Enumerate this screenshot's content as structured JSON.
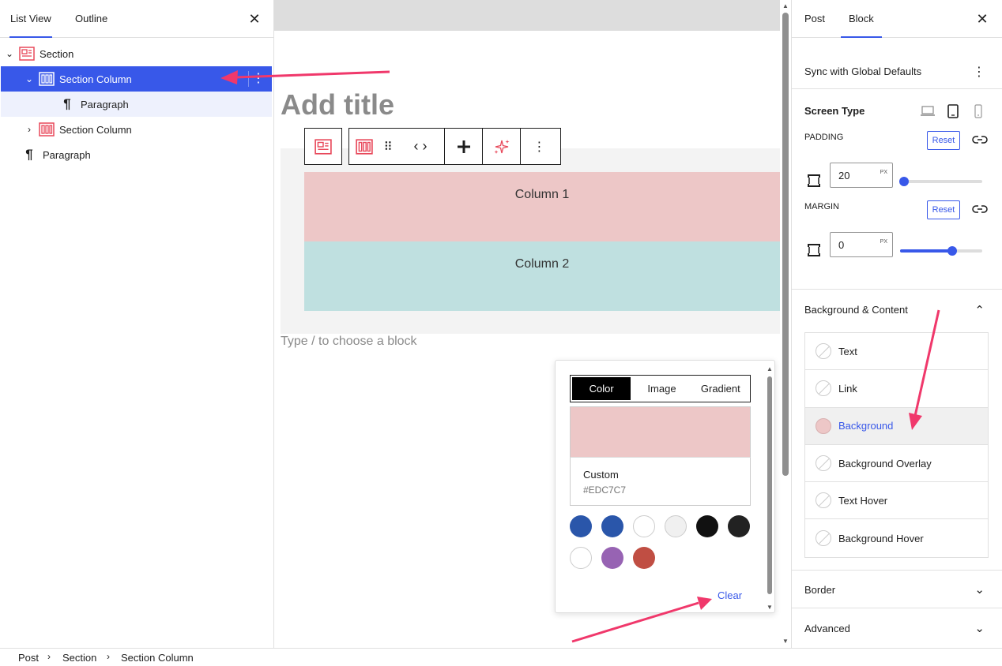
{
  "left_panel": {
    "tabs": [
      "List View",
      "Outline"
    ],
    "active_tab": "List View",
    "close_icon": "close-icon",
    "tree": [
      {
        "label": "Section",
        "depth": 0,
        "expanded": true,
        "icon": "section-icon"
      },
      {
        "label": "Section Column",
        "depth": 1,
        "expanded": true,
        "selected": true,
        "icon": "section-column-icon"
      },
      {
        "label": "Paragraph",
        "depth": 2,
        "icon": "paragraph-icon"
      },
      {
        "label": "Section Column",
        "depth": 1,
        "expanded": false,
        "icon": "section-column-icon"
      },
      {
        "label": "Paragraph",
        "depth": 0,
        "icon": "paragraph-icon"
      }
    ]
  },
  "canvas": {
    "title_placeholder": "Add title",
    "columns": [
      "Column 1",
      "Column 2"
    ],
    "block_hint": "Type / to choose a block",
    "column_colors": [
      "#EDC7C7",
      "#BFE0E0"
    ],
    "toolbar": {
      "buttons": [
        "section-icon",
        "section-column-icon",
        "drag-handle-icon",
        "move-arrows-icon",
        "add-icon",
        "sparkle-icon",
        "more-options-icon"
      ]
    }
  },
  "color_popover": {
    "tabs": [
      "Color",
      "Image",
      "Gradient"
    ],
    "active_tab": "Color",
    "custom_label": "Custom",
    "custom_value": "#EDC7C7",
    "palette": [
      "#2A56AA",
      "#2A56AA",
      "#FFFFFF",
      "#F0F0F0",
      "#111111",
      "#222222",
      "#FFFFFF",
      "#9763B3",
      "#C04E43"
    ],
    "clear_label": "Clear"
  },
  "right_panel": {
    "tabs": [
      "Post",
      "Block"
    ],
    "active_tab": "Block",
    "sync_label": "Sync with Global Defaults",
    "screen_type_label": "Screen Type",
    "screen_icons": [
      "desktop-icon",
      "tablet-icon",
      "mobile-icon"
    ],
    "padding": {
      "label": "PADDING",
      "reset": "Reset",
      "value": "20",
      "unit": "PX",
      "slider_fraction": 0.03
    },
    "margin": {
      "label": "MARGIN",
      "reset": "Reset",
      "value": "0",
      "unit": "PX",
      "slider_fraction": 0.63
    },
    "panels": {
      "background_content": "Background & Content",
      "border": "Border",
      "advanced": "Advanced"
    },
    "color_options": [
      "Text",
      "Link",
      "Background",
      "Background Overlay",
      "Text Hover",
      "Background Hover"
    ],
    "selected_option": "Background"
  },
  "breadcrumb": [
    "Post",
    "Section",
    "Section Column"
  ],
  "colors": {
    "accent": "#3858E9",
    "annotation": "#F0386B"
  }
}
